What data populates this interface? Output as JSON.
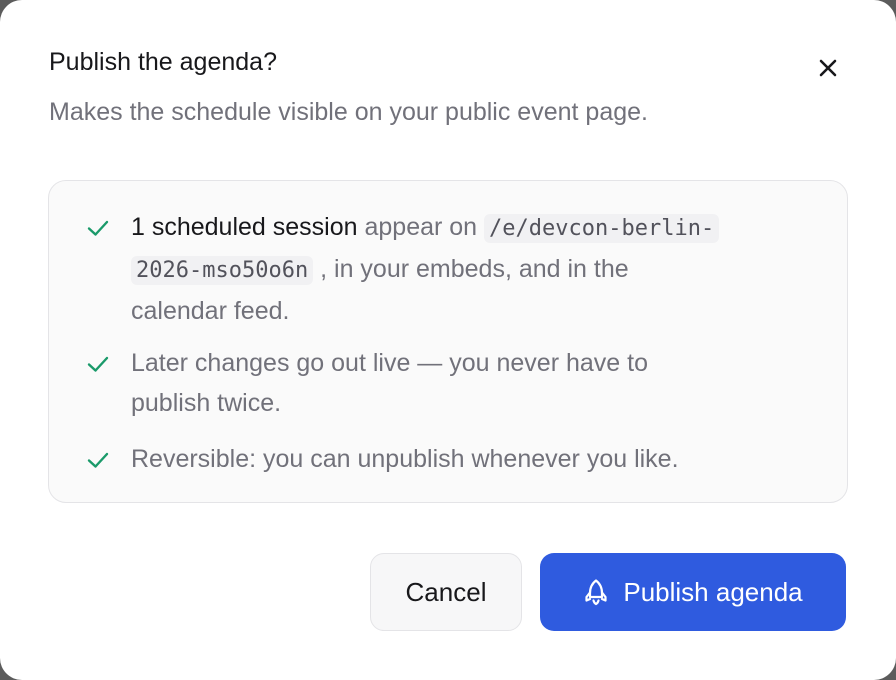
{
  "dialog": {
    "title": "Publish the agenda?",
    "subtitle": "Makes the schedule visible on your public event page.",
    "close_icon": "close-icon"
  },
  "checklist": {
    "icon": "check-icon",
    "accent_color": "#1a9a6a",
    "items": [
      {
        "strong": "1 scheduled session",
        "text_before_code": " appear on ",
        "code_part1": "/e/devcon-berlin-",
        "code_part2": "2026-mso50o6n",
        "text_after_code": ", in your embeds, and in the",
        "text_line3": "calendar feed."
      },
      {
        "line1": "Later changes go out live — you never have to",
        "line2": "publish twice."
      },
      {
        "line1": "Reversible: you can unpublish whenever you like."
      }
    ]
  },
  "actions": {
    "cancel_label": "Cancel",
    "publish_label": "Publish agenda",
    "publish_icon": "rocket-icon",
    "primary_color": "#2f5bdf"
  }
}
